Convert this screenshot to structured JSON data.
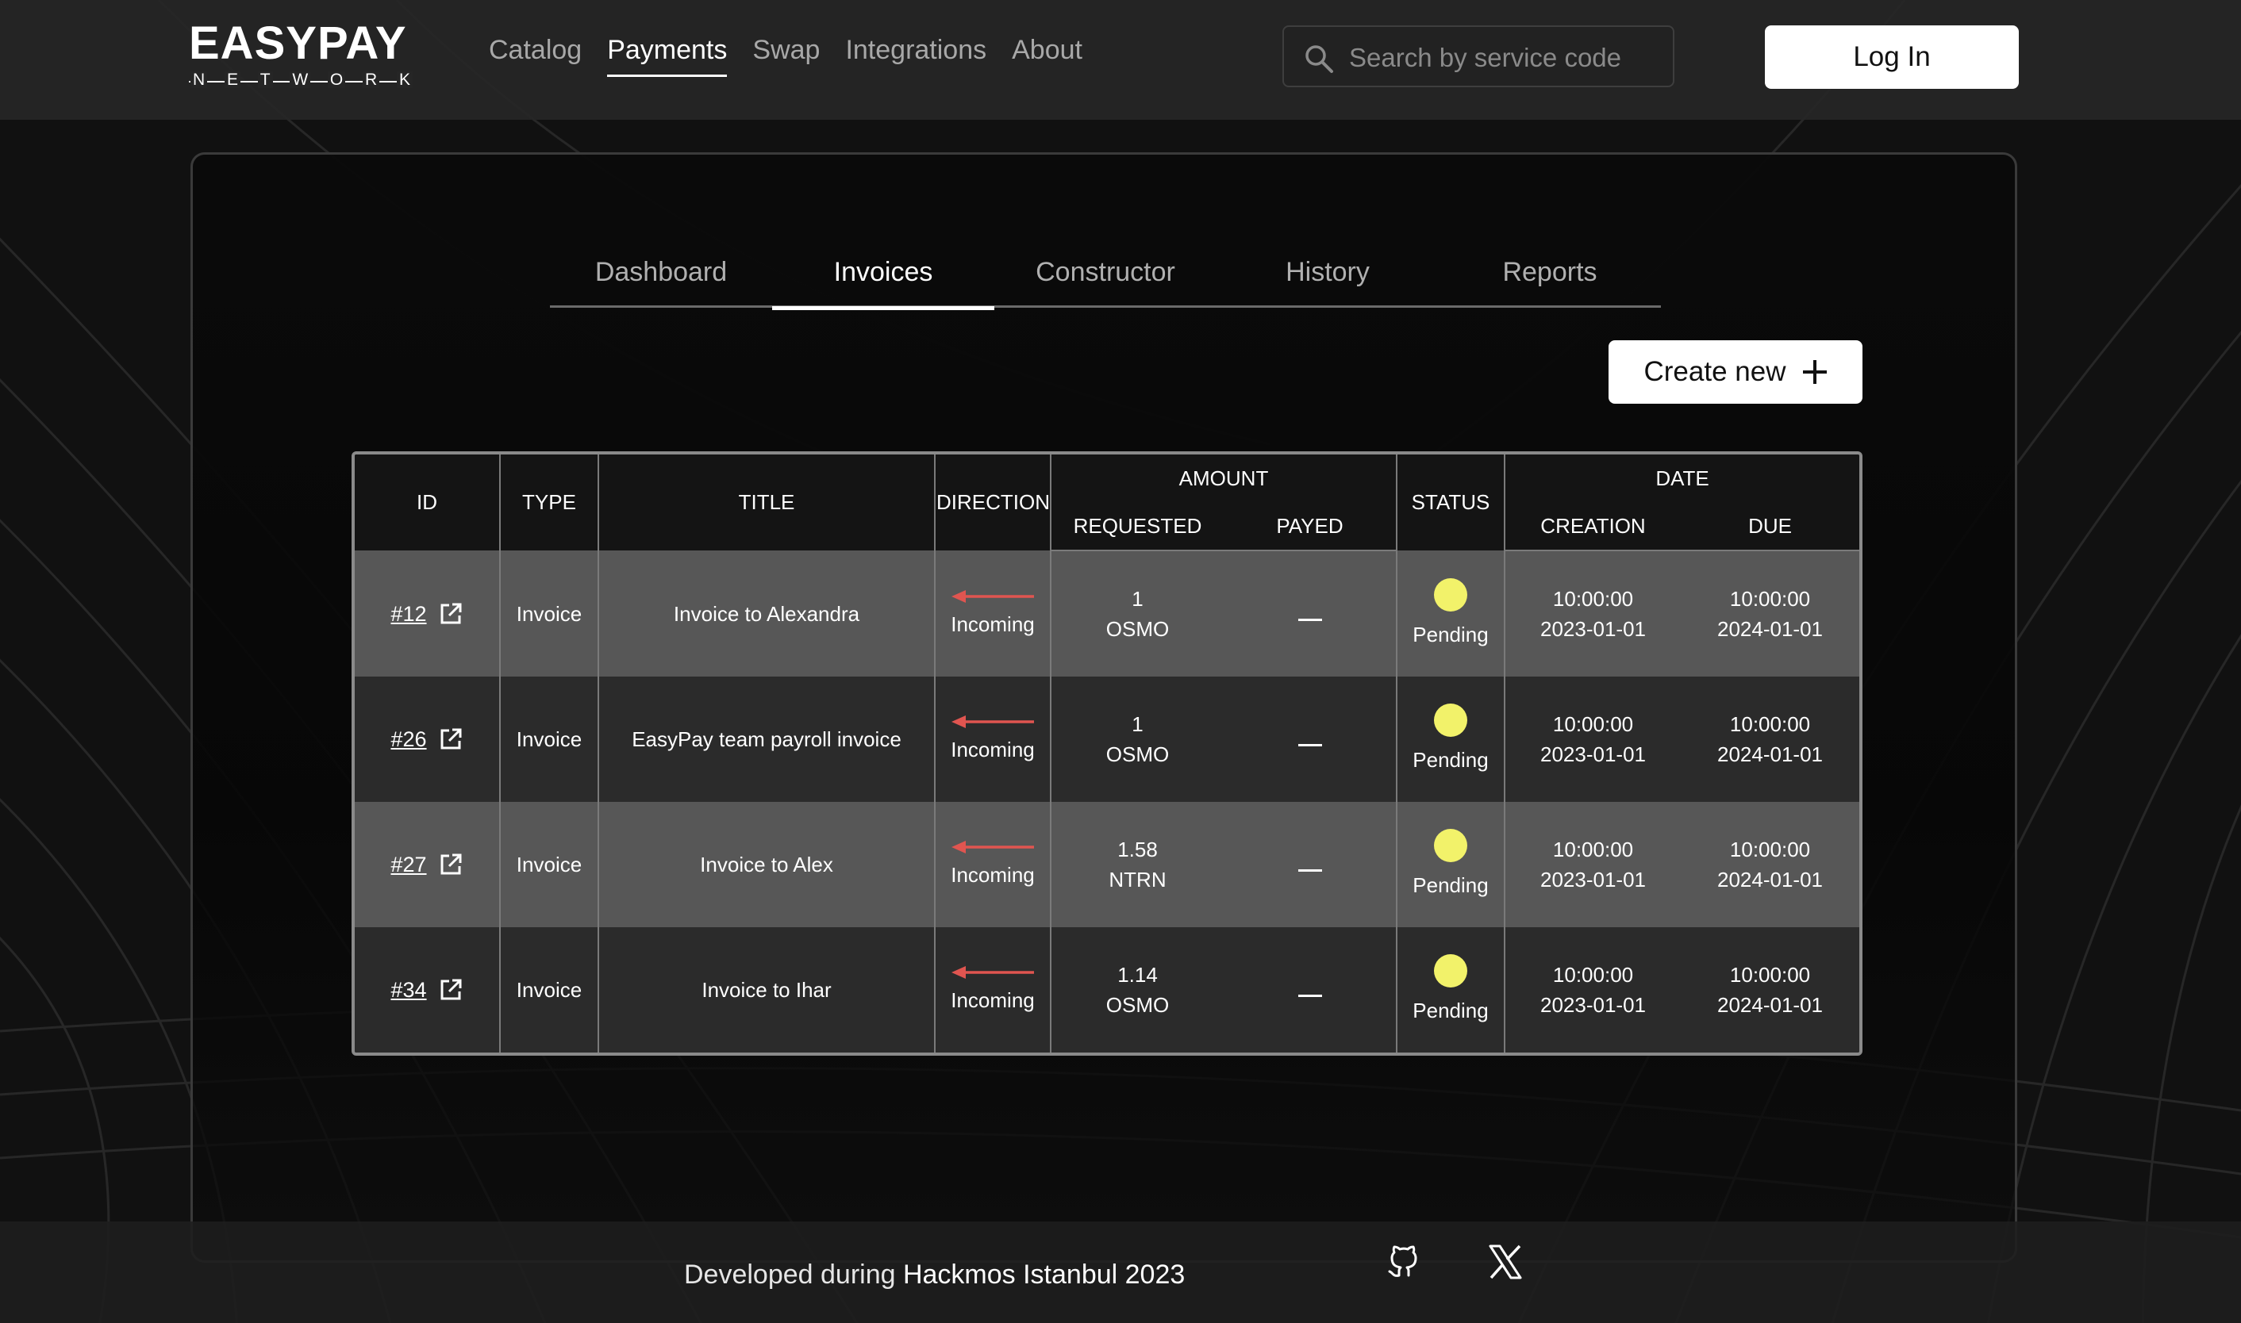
{
  "header": {
    "logo_main": "EASYPAY",
    "logo_sub": [
      "N",
      "E",
      "T",
      "W",
      "O",
      "R",
      "K"
    ],
    "nav": [
      "Catalog",
      "Payments",
      "Swap",
      "Integrations",
      "About"
    ],
    "active_nav": "Payments",
    "search_placeholder": "Search by service code",
    "login_label": "Log In"
  },
  "tabs": [
    "Dashboard",
    "Invoices",
    "Constructor",
    "History",
    "Reports"
  ],
  "active_tab": "Invoices",
  "create_label": "Create new",
  "table": {
    "headers": {
      "id": "ID",
      "type": "TYPE",
      "title": "TITLE",
      "direction": "DIRECTION",
      "amount": "AMOUNT",
      "requested": "REQUESTED",
      "payed": "PAYED",
      "status": "STATUS",
      "date": "DATE",
      "creation": "CREATION",
      "due": "DUE"
    },
    "rows": [
      {
        "id": "#12",
        "type": "Invoice",
        "title": "Invoice to Alexandra",
        "direction": "Incoming",
        "req_amount": "1",
        "req_token": "OSMO",
        "status": "Pending",
        "creation_time": "10:00:00",
        "creation_date": "2023-01-01",
        "due_time": "10:00:00",
        "due_date": "2024-01-01"
      },
      {
        "id": "#26",
        "type": "Invoice",
        "title": "EasyPay team payroll invoice",
        "direction": "Incoming",
        "req_amount": "1",
        "req_token": "OSMO",
        "status": "Pending",
        "creation_time": "10:00:00",
        "creation_date": "2023-01-01",
        "due_time": "10:00:00",
        "due_date": "2024-01-01"
      },
      {
        "id": "#27",
        "type": "Invoice",
        "title": "Invoice to Alex",
        "direction": "Incoming",
        "req_amount": "1.58",
        "req_token": "NTRN",
        "status": "Pending",
        "creation_time": "10:00:00",
        "creation_date": "2023-01-01",
        "due_time": "10:00:00",
        "due_date": "2024-01-01"
      },
      {
        "id": "#34",
        "type": "Invoice",
        "title": "Invoice to Ihar",
        "direction": "Incoming",
        "req_amount": "1.14",
        "req_token": "OSMO",
        "status": "Pending",
        "creation_time": "10:00:00",
        "creation_date": "2023-01-01",
        "due_time": "10:00:00",
        "due_date": "2024-01-01"
      }
    ]
  },
  "footer": {
    "prefix": "Developed during ",
    "event": "Hackmos Istanbul 2023"
  },
  "colors": {
    "pending_dot": "#f2f26a",
    "incoming_arrow": "#e05550",
    "row_light": "#575757",
    "row_dark": "#2b2b2b"
  }
}
